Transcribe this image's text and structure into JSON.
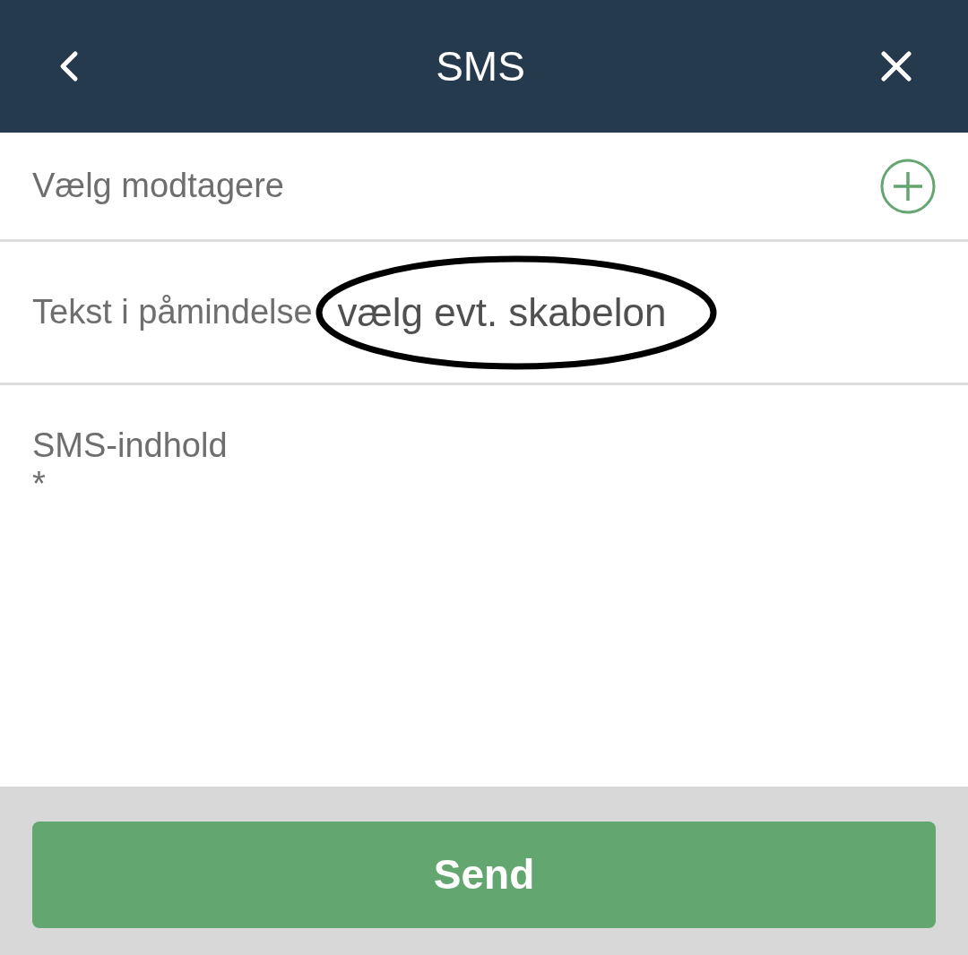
{
  "header": {
    "title": "SMS"
  },
  "recipients": {
    "label": "Vælg modtagere"
  },
  "template": {
    "label": "Tekst i påmindelse",
    "value": "vælg evt. skabelon"
  },
  "content": {
    "label": "SMS-indhold",
    "required_mark": "*"
  },
  "send_button": {
    "label": "Send"
  }
}
